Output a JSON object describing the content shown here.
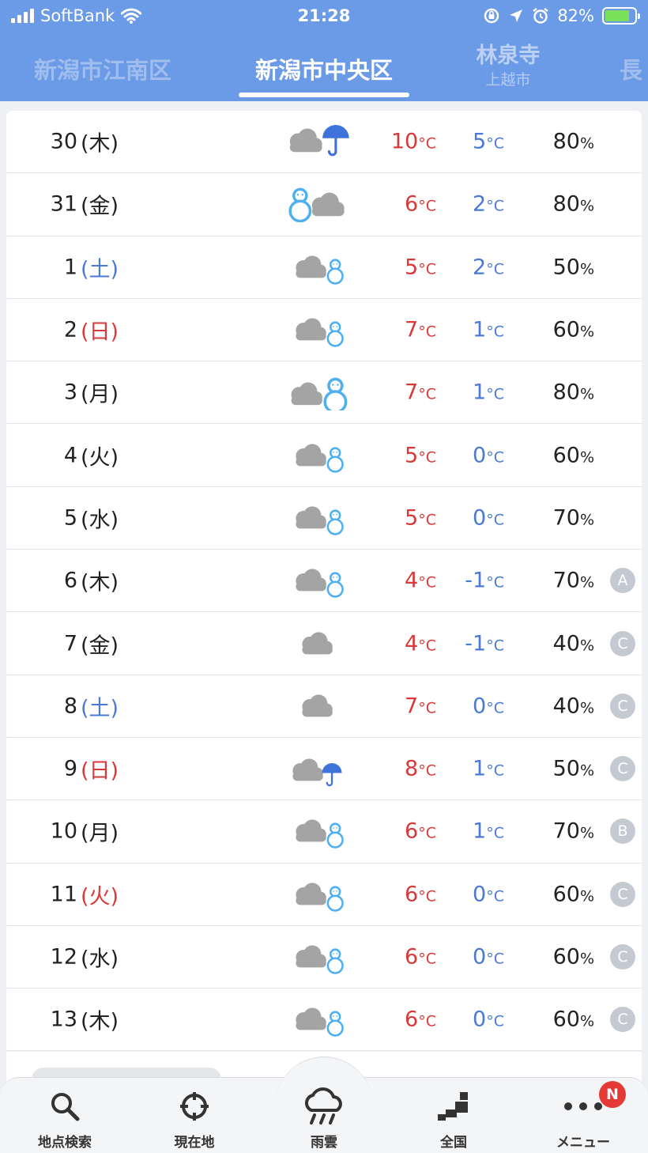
{
  "status_bar": {
    "carrier": "SoftBank",
    "time": "21:28",
    "battery": "82%",
    "battery_level": 0.82
  },
  "location_tabs": [
    {
      "label": "新潟市江南区",
      "state": "previous"
    },
    {
      "label": "新潟市中央区",
      "state": "active"
    },
    {
      "label": "林泉寺",
      "sub": "上越市",
      "state": "next"
    },
    {
      "label": "長",
      "state": "next-peek"
    }
  ],
  "unit_temp": "°C",
  "unit_pct": "%",
  "forecast": [
    {
      "date": "30",
      "dow": "(木)",
      "dow_type": "weekday",
      "weather_icon": "cloud-then-rain-icon",
      "high": "10",
      "low": "5",
      "precip": "80",
      "reliability": ""
    },
    {
      "date": "31",
      "dow": "(金)",
      "dow_type": "weekday",
      "weather_icon": "snow-then-cloud-icon",
      "high": "6",
      "low": "2",
      "precip": "80",
      "reliability": ""
    },
    {
      "date": "1",
      "dow": "(土)",
      "dow_type": "saturday",
      "weather_icon": "cloud-sometimes-snow-icon",
      "high": "5",
      "low": "2",
      "precip": "50",
      "reliability": ""
    },
    {
      "date": "2",
      "dow": "(日)",
      "dow_type": "sunday",
      "weather_icon": "cloud-sometimes-snow-icon",
      "high": "7",
      "low": "1",
      "precip": "60",
      "reliability": ""
    },
    {
      "date": "3",
      "dow": "(月)",
      "dow_type": "weekday",
      "weather_icon": "cloud-then-snow-icon",
      "high": "7",
      "low": "1",
      "precip": "80",
      "reliability": ""
    },
    {
      "date": "4",
      "dow": "(火)",
      "dow_type": "weekday",
      "weather_icon": "cloud-sometimes-snow-icon",
      "high": "5",
      "low": "0",
      "precip": "60",
      "reliability": ""
    },
    {
      "date": "5",
      "dow": "(水)",
      "dow_type": "weekday",
      "weather_icon": "cloud-sometimes-snow-icon",
      "high": "5",
      "low": "0",
      "precip": "70",
      "reliability": ""
    },
    {
      "date": "6",
      "dow": "(木)",
      "dow_type": "weekday",
      "weather_icon": "cloud-sometimes-snow-icon",
      "high": "4",
      "low": "-1",
      "precip": "70",
      "reliability": "A"
    },
    {
      "date": "7",
      "dow": "(金)",
      "dow_type": "weekday",
      "weather_icon": "cloud-icon",
      "high": "4",
      "low": "-1",
      "precip": "40",
      "reliability": "C"
    },
    {
      "date": "8",
      "dow": "(土)",
      "dow_type": "saturday",
      "weather_icon": "cloud-icon",
      "high": "7",
      "low": "0",
      "precip": "40",
      "reliability": "C"
    },
    {
      "date": "9",
      "dow": "(日)",
      "dow_type": "sunday",
      "weather_icon": "cloud-sometimes-rain-icon",
      "high": "8",
      "low": "1",
      "precip": "50",
      "reliability": "C"
    },
    {
      "date": "10",
      "dow": "(月)",
      "dow_type": "weekday",
      "weather_icon": "cloud-sometimes-snow-icon",
      "high": "6",
      "low": "1",
      "precip": "70",
      "reliability": "B"
    },
    {
      "date": "11",
      "dow": "(火)",
      "dow_type": "sunday",
      "weather_icon": "cloud-sometimes-snow-icon",
      "high": "6",
      "low": "0",
      "precip": "60",
      "reliability": "C"
    },
    {
      "date": "12",
      "dow": "(水)",
      "dow_type": "weekday",
      "weather_icon": "cloud-sometimes-snow-icon",
      "high": "6",
      "low": "0",
      "precip": "60",
      "reliability": "C"
    },
    {
      "date": "13",
      "dow": "(木)",
      "dow_type": "weekday",
      "weather_icon": "cloud-sometimes-snow-icon",
      "high": "6",
      "low": "0",
      "precip": "60",
      "reliability": "C"
    }
  ],
  "bottom_nav": [
    {
      "label": "地点検索",
      "icon": "search-icon"
    },
    {
      "label": "現在地",
      "icon": "crosshair-icon"
    },
    {
      "label": "雨雲",
      "icon": "rain-cloud-icon"
    },
    {
      "label": "全国",
      "icon": "japan-map-icon"
    },
    {
      "label": "メニュー",
      "icon": "more-icon"
    }
  ],
  "menu_badge": "N",
  "colors": {
    "header": "#6b9ae6",
    "high_temp": "#d83a3a",
    "low_temp": "#4a79d6",
    "saturday": "#4a79d6",
    "sunday": "#d83a3a",
    "badge": "#e53935"
  }
}
